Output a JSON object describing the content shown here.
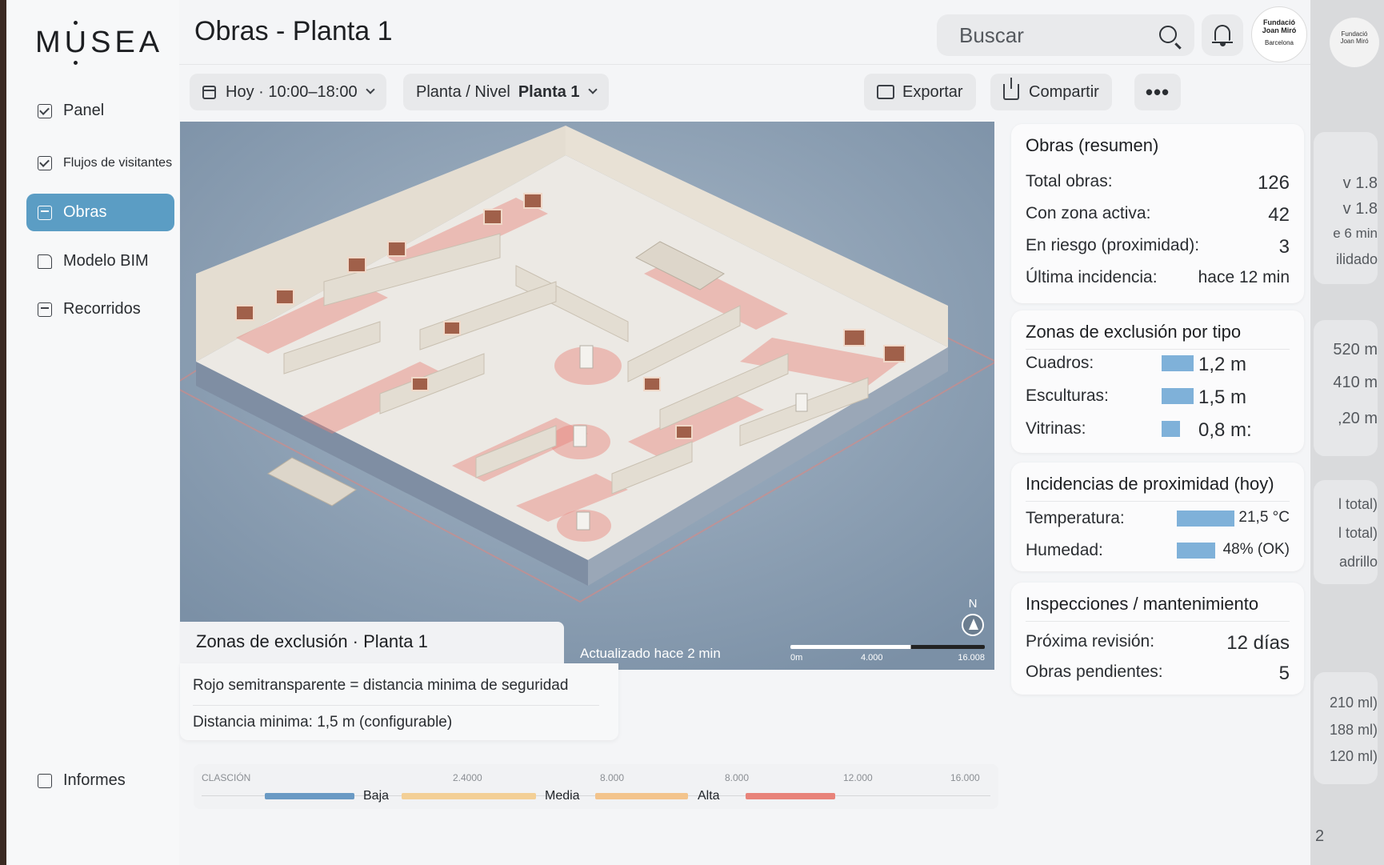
{
  "app": {
    "logo": "MUSEA",
    "page_title": "Obras - Planta 1",
    "search_placeholder": "Buscar",
    "org_logo": {
      "line1": "Fundació",
      "line2": "Joan Miró",
      "line3": "Barcelona"
    }
  },
  "sidebar": {
    "items": [
      {
        "label": "Panel",
        "icon": "check-square-icon"
      },
      {
        "label": "Flujos de visitantes",
        "icon": "check-square-icon"
      },
      {
        "label": "Obras",
        "icon": "list-square-icon",
        "active": true
      },
      {
        "label": "Modelo BIM",
        "icon": "document-icon"
      },
      {
        "label": "Recorridos",
        "icon": "list-square-icon"
      }
    ],
    "footer_item": {
      "label": "Informes",
      "icon": "square-icon"
    }
  },
  "toolbar": {
    "date_range": "Hoy · 10:00–18:00",
    "level_label": "Planta / Nivel",
    "level_value": "Planta 1",
    "export_label": "Exportar",
    "share_label": "Compartir",
    "more_label": "•••"
  },
  "map": {
    "zone_title": "Zonas de exclusión · Planta 1",
    "updated": "Actualizado hace 2 min",
    "north": "N",
    "scale_labels": [
      "0m",
      "4.000",
      "16.008"
    ],
    "legend_line1": "Rojo semitransparente = distancia minima de seguridad",
    "legend_line2": "Distancia minima: 1,5 m (configurable)"
  },
  "rangebar": {
    "title": "CLASCIÓN",
    "ticks": [
      "2.4000",
      "8.000",
      "8.000",
      "12.000",
      "16.000"
    ],
    "levels": [
      {
        "label": "Baja",
        "color": "#6a9ac4"
      },
      {
        "label": "Media",
        "color": "#f3cf96"
      },
      {
        "label": "Alta",
        "color": "#e8837a"
      }
    ],
    "media_bar_color": "#f3c48c"
  },
  "cards": {
    "summary": {
      "title": "Obras (resumen)",
      "rows": [
        {
          "label": "Total obras:",
          "value": "126"
        },
        {
          "label": "Con zona activa:",
          "value": "42"
        },
        {
          "label": "En riesgo (proximidad):",
          "value": "3"
        },
        {
          "label": "Última incidencia:",
          "value": "hace 12 min"
        }
      ]
    },
    "exclusion": {
      "title": "Zonas de exclusión por tipo",
      "rows": [
        {
          "label": "Cuadros:",
          "value": "1,2 m",
          "fraction": 0.8
        },
        {
          "label": "Esculturas:",
          "value": "1,5 m",
          "fraction": 0.8
        },
        {
          "label": "Vitrinas:",
          "value": "0,8 m:",
          "fraction": 0.45
        }
      ],
      "bar_color": "#7fb1d9"
    },
    "proximity": {
      "title": "Incidencias de proximidad (hoy)",
      "rows": [
        {
          "label": "Temperatura:",
          "value": "21,5 °C",
          "fraction": 1.0
        },
        {
          "label": "Humedad:",
          "value": "48% (OK)",
          "fraction": 0.67
        }
      ]
    },
    "maintenance": {
      "title": "Inspecciones / mantenimiento",
      "rows": [
        {
          "label": "Próxima revisión:",
          "value": "12 días"
        },
        {
          "label": "Obras pendientes:",
          "value": "5"
        }
      ]
    }
  },
  "background_panel": {
    "texts": [
      "v 1.8",
      "v 1.8",
      "e 6 min",
      "ilidado",
      "520 m",
      "410 m",
      ",20 m",
      "l total)",
      "l total)",
      "adrillo",
      "210 ml)",
      "188 ml)",
      "120 ml)",
      "2"
    ]
  },
  "colors": {
    "accent": "#5b9dc4",
    "zone_red": "#e8837a",
    "map_bg": "#8fa2b6"
  }
}
